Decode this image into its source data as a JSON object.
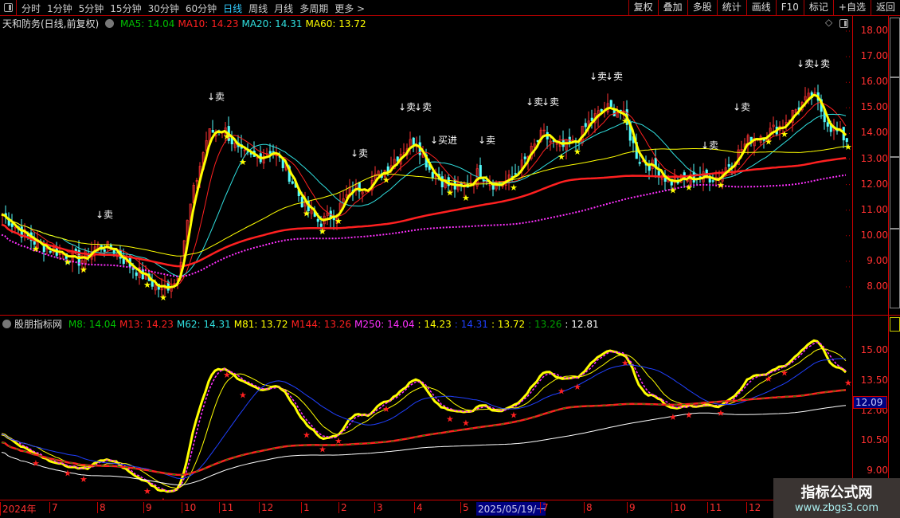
{
  "toolbar": {
    "periods": [
      "分时",
      "1分钟",
      "5分钟",
      "15分钟",
      "30分钟",
      "60分钟",
      "日线",
      "周线",
      "月线",
      "多周期",
      "更多 >"
    ],
    "active": "日线",
    "actions": [
      "复权",
      "叠加",
      "多股",
      "统计",
      "画线",
      "F10",
      "标记",
      "+自选",
      "返回"
    ]
  },
  "main": {
    "title": "天和防务(日线,前复权)",
    "ma": [
      {
        "label": "MA5: 14.04",
        "color": "#00c000"
      },
      {
        "label": "MA10: 14.23",
        "color": "#ff2020"
      },
      {
        "label": "MA20: 14.31",
        "color": "#30e0e0"
      },
      {
        "label": "MA60: 13.72",
        "color": "#ffff00"
      }
    ],
    "axis": [
      "18.00",
      "17.00",
      "16.00",
      "15.00",
      "14.00",
      "13.00",
      "12.00",
      "11.00",
      "10.00",
      "9.00",
      "8.00"
    ]
  },
  "indicator": {
    "title": "股朋指标网",
    "values": [
      {
        "label": "M8: 14.04",
        "color": "#00c000"
      },
      {
        "label": "M13: 14.23",
        "color": "#ff2020"
      },
      {
        "label": "M62: 14.31",
        "color": "#30e0e0"
      },
      {
        "label": "M81: 13.72",
        "color": "#ffff00"
      },
      {
        "label": "M144: 13.26",
        "color": "#ff2020"
      },
      {
        "label": "M250: 14.04",
        "color": "#ff30ff"
      },
      {
        "label": ": 14.23",
        "color": "#ffff00"
      },
      {
        "label": ": 14.31",
        "color": "#2040ff"
      },
      {
        "label": ": 13.72",
        "color": "#ffff00"
      },
      {
        "label": ": 13.26",
        "color": "#00a000"
      },
      {
        "label": ": 12.81",
        "color": "#ffffff"
      }
    ],
    "axis": [
      "15.00",
      "13.50",
      "12.00",
      "10.50",
      "9.00"
    ],
    "current": "12.09"
  },
  "dates": [
    "2024年",
    "7",
    "8",
    "9",
    "10",
    "11",
    "12",
    "1",
    "2",
    "3",
    "4",
    "5",
    "2025/05/19/一",
    "7",
    "8",
    "9",
    "10",
    "11",
    "12"
  ],
  "watermark": {
    "title": "指标公式网",
    "url": "www.zbgs3.com"
  },
  "chart_data": {
    "type": "candlestick",
    "closes": [
      10.9,
      10.3,
      9.8,
      9.5,
      9.3,
      9.0,
      9.6,
      9.5,
      8.9,
      8.4,
      7.9,
      8.2,
      11.5,
      14.0,
      14.2,
      13.2,
      13.0,
      13.4,
      12.5,
      11.2,
      10.5,
      10.9,
      11.8,
      12.0,
      12.5,
      13.2,
      13.8,
      12.5,
      12.0,
      11.8,
      12.5,
      12.0,
      12.2,
      13.0,
      14.0,
      13.4,
      13.6,
      14.5,
      15.0,
      14.8,
      13.0,
      12.7,
      12.1,
      12.2,
      12.3,
      12.3,
      13.0,
      13.8,
      14.0,
      14.3,
      15.0,
      15.5,
      14.3,
      13.8
    ],
    "ylim": [
      7.5,
      18.3
    ],
    "indicator_ylim": [
      8.5,
      16.2
    ],
    "signals": [
      {
        "i": 6,
        "text": "↓卖"
      },
      {
        "i": 13,
        "text": "↓卖"
      },
      {
        "i": 22,
        "text": "↓卖"
      },
      {
        "i": 25,
        "text": "↓卖"
      },
      {
        "i": 26,
        "text": "↓卖"
      },
      {
        "i": 27,
        "text": "↓买进"
      },
      {
        "i": 30,
        "text": "↓卖"
      },
      {
        "i": 33,
        "text": "↓卖"
      },
      {
        "i": 34,
        "text": "↓卖"
      },
      {
        "i": 37,
        "text": "↓卖"
      },
      {
        "i": 38,
        "text": "↓卖"
      },
      {
        "i": 44,
        "text": "↓卖"
      },
      {
        "i": 46,
        "text": "↓卖"
      },
      {
        "i": 50,
        "text": "↓卖"
      },
      {
        "i": 51,
        "text": "↓卖"
      }
    ]
  }
}
